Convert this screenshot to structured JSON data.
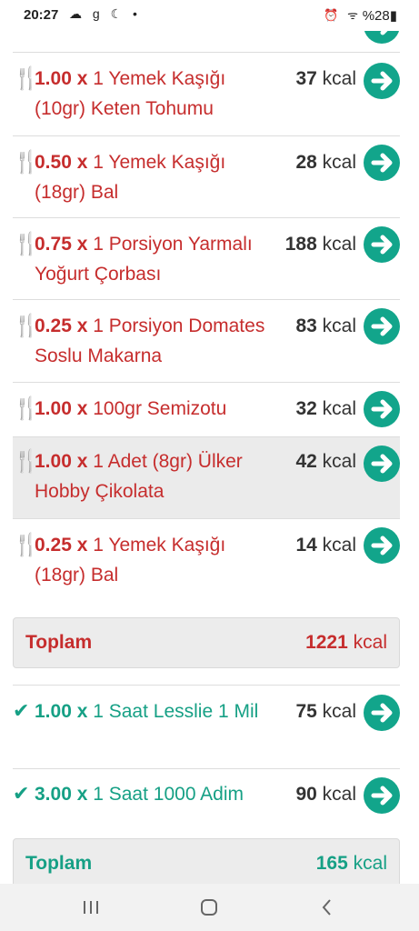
{
  "status_bar": {
    "time": "20:27",
    "left_icons": "☁ g ☾ •",
    "right_icons": "⏰ ᯤ ",
    "battery": "%28"
  },
  "food_items": [
    {
      "qty": "1.00 x",
      "desc": "1 Yemek Kaşığı (10gr) Keten Tohumu",
      "kcal": "37",
      "unit": "kcal"
    },
    {
      "qty": "0.50 x",
      "desc": "1 Yemek Kaşığı (18gr) Bal",
      "kcal": "28",
      "unit": "kcal"
    },
    {
      "qty": "0.75 x",
      "desc": "1 Porsiyon Yarmalı Yoğurt Çorbası",
      "kcal": "188",
      "unit": "kcal"
    },
    {
      "qty": "0.25 x",
      "desc": "1 Porsiyon Domates Soslu Makarna",
      "kcal": "83",
      "unit": "kcal"
    },
    {
      "qty": "1.00 x",
      "desc": "100gr Semizotu",
      "kcal": "32",
      "unit": "kcal"
    },
    {
      "qty": "1.00 x",
      "desc": "1 Adet (8gr) Ülker Hobby Çikolata",
      "kcal": "42",
      "unit": "kcal"
    },
    {
      "qty": "0.25 x",
      "desc": "1 Yemek Kaşığı (18gr) Bal",
      "kcal": "14",
      "unit": "kcal"
    }
  ],
  "food_total": {
    "label": "Toplam",
    "kcal": "1221",
    "unit": "kcal"
  },
  "exercise_items": [
    {
      "qty": "1.00 x",
      "desc": "1 Saat Lesslie 1 Mil",
      "kcal": "75",
      "unit": "kcal"
    },
    {
      "qty": "3.00 x",
      "desc": "1 Saat 1000 Adim",
      "kcal": "90",
      "unit": "kcal"
    }
  ],
  "exercise_total": {
    "label": "Toplam",
    "kcal": "165",
    "unit": "kcal"
  },
  "colors": {
    "food": "#c62d2d",
    "exercise": "#16a085",
    "arrow": "#12a58b"
  },
  "icons": {
    "food": "fork-knife-icon",
    "exercise": "checkmark-icon",
    "go": "arrow-right-circle-icon"
  }
}
